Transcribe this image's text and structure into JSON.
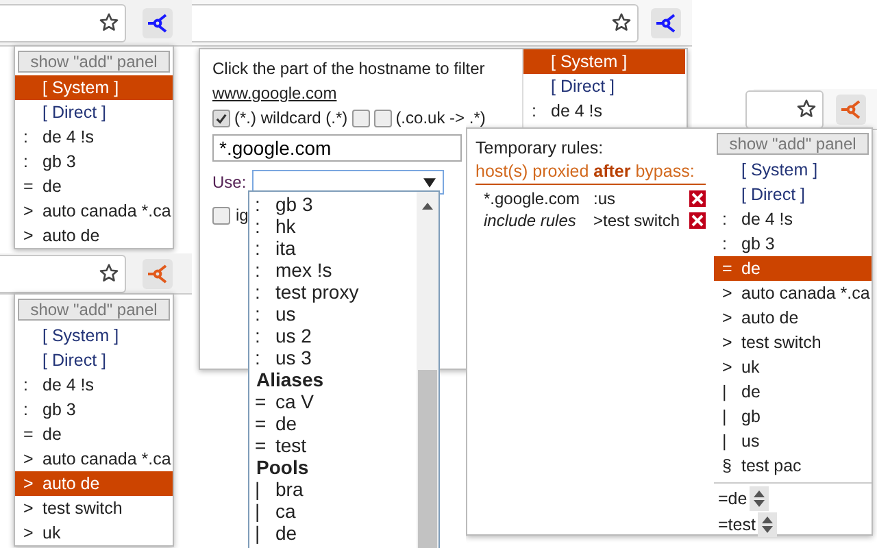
{
  "popup_top_left": {
    "menu": {
      "add_button": "show \"add\" panel",
      "items": [
        {
          "label": "[ System ]",
          "selected": true
        },
        {
          "label": "[ Direct ]",
          "selected": false
        },
        {
          "mark": ":",
          "label": "de 4 !s",
          "selected": false
        },
        {
          "mark": ":",
          "label": "gb 3",
          "selected": false
        },
        {
          "mark": "=",
          "label": "de",
          "selected": false
        },
        {
          "mark": ">",
          "label": "auto canada *.ca",
          "selected": false
        },
        {
          "mark": ">",
          "label": "auto de",
          "selected": false
        }
      ]
    }
  },
  "popup_bottom_left": {
    "menu": {
      "add_button": "show \"add\" panel",
      "items": [
        {
          "label": "[ System ]",
          "selected": false
        },
        {
          "label": "[ Direct ]",
          "selected": false
        },
        {
          "mark": ":",
          "label": "de 4 !s",
          "selected": false
        },
        {
          "mark": ":",
          "label": "gb 3",
          "selected": false
        },
        {
          "mark": "=",
          "label": "de",
          "selected": false
        },
        {
          "mark": ">",
          "label": "auto canada *.ca",
          "selected": false
        },
        {
          "mark": ">",
          "label": "auto de",
          "selected": true
        },
        {
          "mark": ">",
          "label": "test switch",
          "selected": false
        },
        {
          "mark": ">",
          "label": "uk",
          "selected": false
        }
      ]
    }
  },
  "popup_filter": {
    "instruction": "Click the part of the hostname to filter",
    "hostname": "www.google.com",
    "checkboxes": [
      {
        "checked": true,
        "label": "(*.) wildcard (.*)"
      },
      {
        "checked": false
      },
      {
        "checked": false,
        "label": "(.co.uk -> .*)"
      }
    ],
    "pattern": "*.google.com",
    "use_label": "Use:",
    "ignore": {
      "checked": false,
      "label": "ig"
    },
    "dropdown": [
      {
        "kind": "option",
        "mark": ":",
        "label": "gb 3"
      },
      {
        "kind": "option",
        "mark": ":",
        "label": "hk"
      },
      {
        "kind": "option",
        "mark": ":",
        "label": "ita"
      },
      {
        "kind": "option",
        "mark": ":",
        "label": "mex !s"
      },
      {
        "kind": "option",
        "mark": ":",
        "label": "test proxy"
      },
      {
        "kind": "option",
        "mark": ":",
        "label": "us"
      },
      {
        "kind": "option",
        "mark": ":",
        "label": "us 2"
      },
      {
        "kind": "option",
        "mark": ":",
        "label": "us 3"
      },
      {
        "kind": "group",
        "label": "Aliases"
      },
      {
        "kind": "option",
        "mark": "=",
        "label": "ca V"
      },
      {
        "kind": "option",
        "mark": "=",
        "label": "de"
      },
      {
        "kind": "option",
        "mark": "=",
        "label": "test"
      },
      {
        "kind": "group",
        "label": "Pools"
      },
      {
        "kind": "option",
        "mark": "|",
        "label": "bra"
      },
      {
        "kind": "option",
        "mark": "|",
        "label": "ca"
      },
      {
        "kind": "option",
        "mark": "|",
        "label": "de"
      }
    ],
    "menu": {
      "items": [
        {
          "label": "[ System ]",
          "selected": true
        },
        {
          "label": "[ Direct ]",
          "selected": false
        },
        {
          "mark": ":",
          "label": "de 4 !s",
          "selected": false
        }
      ]
    }
  },
  "popup_rules": {
    "title": "Temporary rules:",
    "subtitle": "host(s) proxied **after** bypass:",
    "rules": [
      {
        "kind": "pattern",
        "host": "*.google.com",
        "proxy": ":us"
      },
      {
        "kind": "include",
        "host": "include rules",
        "proxy": ">test switch"
      }
    ],
    "menu": {
      "add_button": "show \"add\" panel",
      "items": [
        {
          "label": "[ System ]",
          "selected": false
        },
        {
          "label": "[ Direct ]",
          "selected": false
        },
        {
          "mark": ":",
          "label": "de 4 !s",
          "selected": false
        },
        {
          "mark": ":",
          "label": "gb 3",
          "selected": false
        },
        {
          "mark": "=",
          "label": "de",
          "selected": true
        },
        {
          "mark": ">",
          "label": "auto canada *.ca",
          "selected": false
        },
        {
          "mark": ">",
          "label": "auto de",
          "selected": false
        },
        {
          "mark": ">",
          "label": "test switch",
          "selected": false
        },
        {
          "mark": ">",
          "label": "uk",
          "selected": false
        },
        {
          "mark": "|",
          "label": "de",
          "selected": false
        },
        {
          "mark": "|",
          "label": "gb",
          "selected": false
        },
        {
          "mark": "|",
          "label": "us",
          "selected": false
        },
        {
          "mark": "§",
          "label": "test pac",
          "selected": false
        }
      ]
    },
    "spinners": [
      {
        "label": "=de"
      },
      {
        "label": "=test"
      }
    ]
  }
}
